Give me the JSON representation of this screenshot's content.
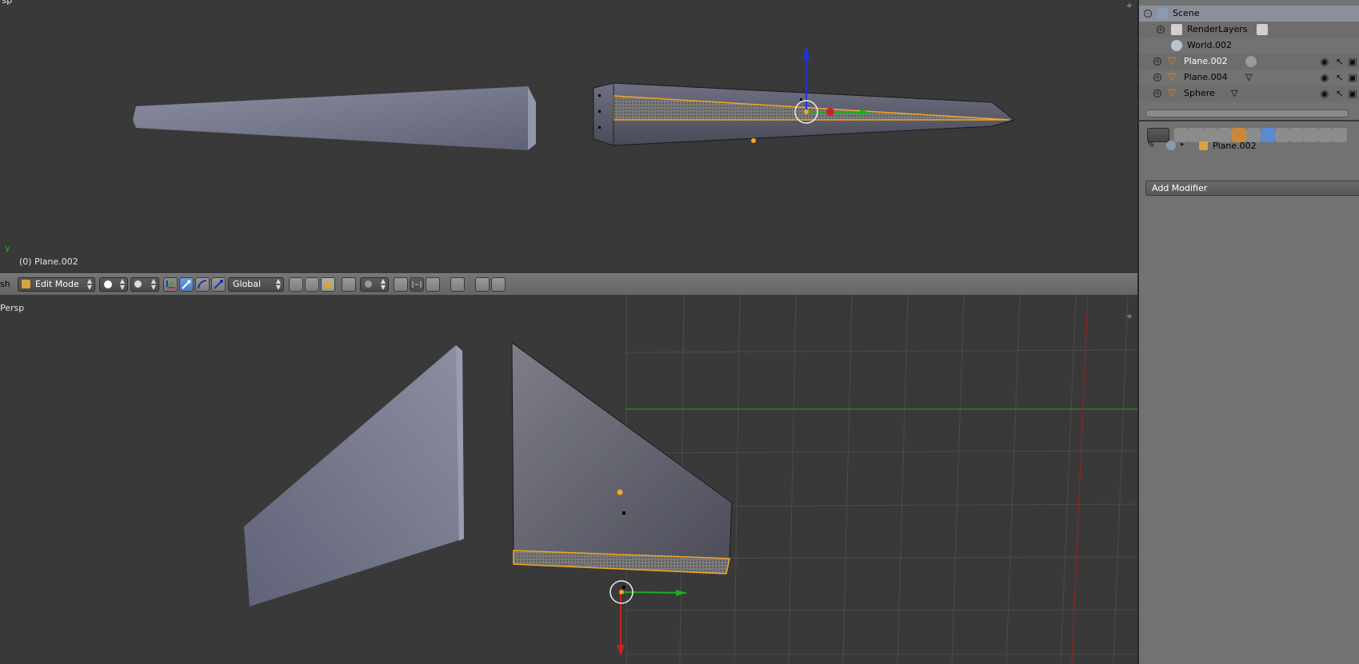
{
  "top_viewport": {
    "label": "rsp",
    "object_label": "(0) Plane.002",
    "axis_label": "y"
  },
  "header": {
    "menu_partial": "sh",
    "mode_label": "Edit Mode",
    "orientation_label": "Global"
  },
  "bottom_viewport": {
    "label": "Persp"
  },
  "outliner": {
    "rows": [
      {
        "label": "Scene",
        "icon": "scene-icon"
      },
      {
        "label": "RenderLayers",
        "icon": "render-layers-icon"
      },
      {
        "label": "World.002",
        "icon": "world-icon"
      },
      {
        "label": "Plane.002",
        "icon": "mesh-icon"
      },
      {
        "label": "Plane.004",
        "icon": "mesh-icon"
      },
      {
        "label": "Sphere",
        "icon": "mesh-icon"
      }
    ]
  },
  "properties": {
    "context_object": "Plane.002",
    "add_modifier_label": "Add Modifier"
  },
  "colors": {
    "viewport_bg": "#393939",
    "selection_orange": "#f5a623",
    "axis_x": "#cc2222",
    "axis_y": "#22aa22",
    "axis_z": "#2233cc"
  }
}
